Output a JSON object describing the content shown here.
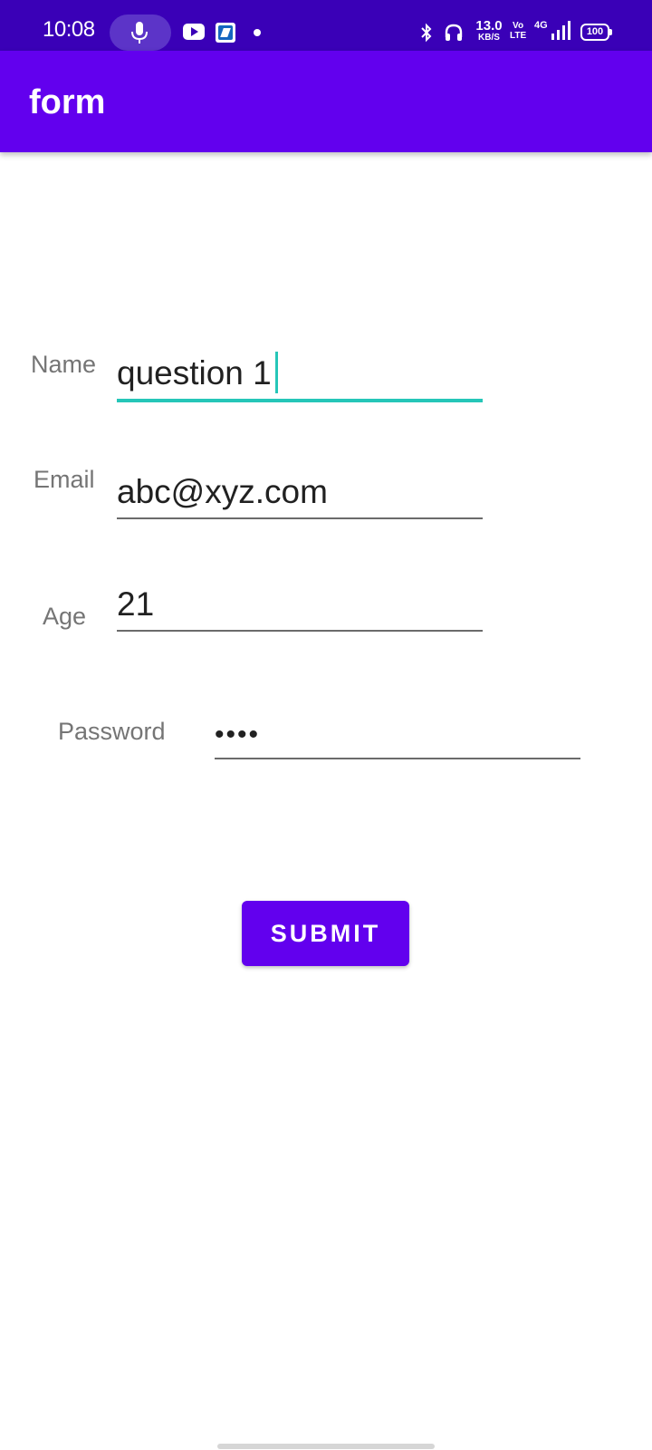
{
  "status_bar": {
    "time": "10:08",
    "speed_value": "13.0",
    "speed_unit": "KB/S",
    "volte_top": "Vo",
    "volte_bottom": "LTE",
    "network": "4G",
    "battery": "100"
  },
  "app_bar": {
    "title": "form"
  },
  "form": {
    "name_label": "Name",
    "name_value": "question 1",
    "email_label": "Email",
    "email_value": "abc@xyz.com",
    "age_label": "Age",
    "age_value": "21",
    "password_label": "Password",
    "password_value": "••••"
  },
  "submit_label": "SUBMIT",
  "colors": {
    "status_bar": "#3A00B7",
    "primary": "#6200EE",
    "focus_accent": "#26C6B8"
  }
}
